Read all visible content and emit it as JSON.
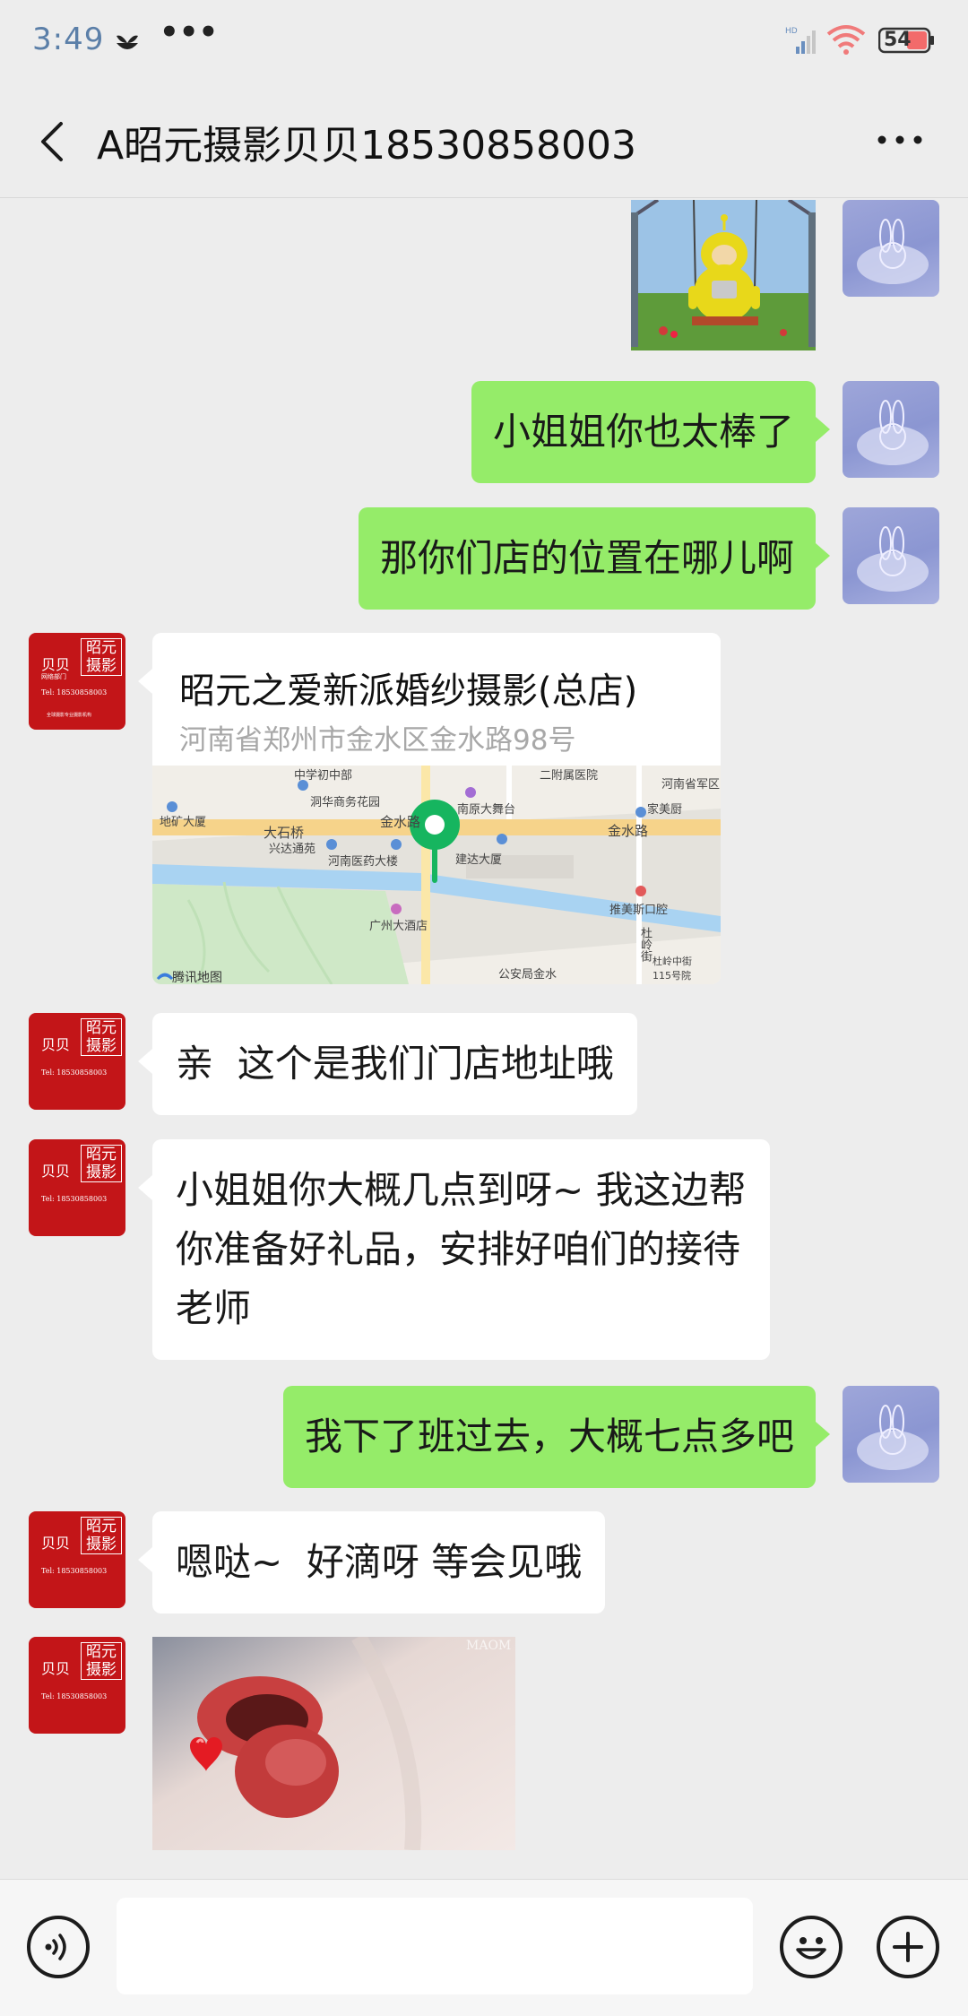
{
  "status_bar": {
    "time": "3:49",
    "indicators": "•••",
    "network": "HD",
    "battery": "54"
  },
  "chat": {
    "title": "A昭元摄影贝贝18530858003",
    "back_icon": "back-arrow-icon",
    "more_icon": "more-dots-icon"
  },
  "messages": [
    {
      "from": "me",
      "type": "image",
      "image": "teletubby-swing-sticker"
    },
    {
      "from": "me",
      "type": "text",
      "text": "小姐姐你也太棒了"
    },
    {
      "from": "me",
      "type": "text",
      "text": "那你们店的位置在哪儿啊"
    },
    {
      "from": "them",
      "type": "location",
      "name": "昭元之爱新派婚纱摄影(总店)",
      "address": "河南省郑州市金水区金水路98号",
      "map_labels": [
        "中学初中部",
        "洞华商务花园",
        "二附属医院",
        "河南省军区",
        "家美厨",
        "地矿大厦",
        "大石桥",
        "金水路",
        "南原大舞台",
        "金水路",
        "兴达通苑",
        "河南医药大楼",
        "建达大厦",
        "推美斯口腔",
        "广州大酒店",
        "杜岭街",
        "杜岭中街115号院",
        "公安局金水",
        "腾讯地图"
      ]
    },
    {
      "from": "them",
      "type": "text",
      "text": "亲  这个是我们门店地址哦"
    },
    {
      "from": "them",
      "type": "text",
      "lines": [
        "小姐姐你大概几点到呀~ 我这边帮",
        "你准备好礼品，安排好咱们的接待",
        "老师"
      ]
    },
    {
      "from": "me",
      "type": "text",
      "text": "我下了班过去，大概七点多吧"
    },
    {
      "from": "them",
      "type": "text",
      "text": "嗯哒~  好滴呀 等会见哦"
    },
    {
      "from": "them",
      "type": "image",
      "image": "lips-heart-photo",
      "watermark": "MAOM"
    }
  ],
  "shop_avatar": {
    "brand_line1": "昭元",
    "brand_line2": "摄影",
    "name": "贝贝",
    "sub": "网络部门",
    "tel": "Tel: 18530858003",
    "footer": "全球摄影专业摄影机构"
  },
  "input_bar": {
    "voice_icon": "voice-icon",
    "emoji_icon": "emoji-icon",
    "plus_icon": "plus-icon",
    "placeholder": ""
  },
  "colors": {
    "my_bubble": "#95ec69",
    "their_bubble": "#ffffff",
    "background": "#ededed",
    "shop_avatar": "#c31518",
    "map_pin": "#16b55f"
  }
}
